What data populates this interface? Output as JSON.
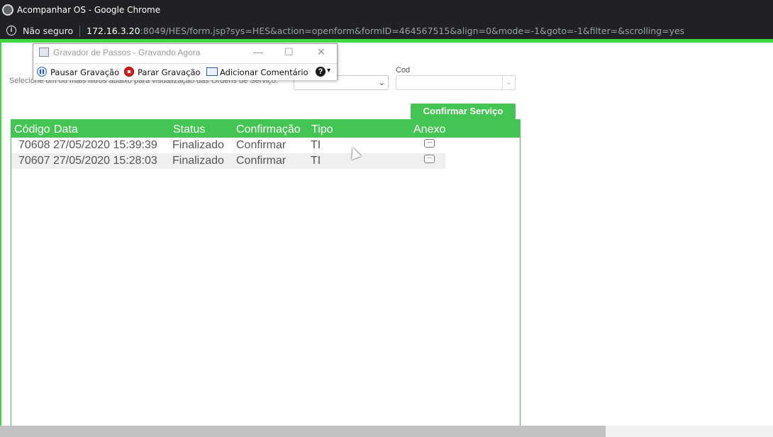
{
  "window": {
    "title": "Acompanhar OS - Google Chrome"
  },
  "addressbar": {
    "security_label": "Não seguro",
    "url_host": "172.16.3.20",
    "url_rest": ":8049/HES/form.jsp?sys=HES&action=openform&formID=464567515&align=0&mode=-1&goto=-1&filter=&scrolling=yes"
  },
  "recorder": {
    "title": "Gravador de Passos - Gravando Agora",
    "minimize": "—",
    "maximize": "☐",
    "close": "✕",
    "pause_label": "Pausar Gravação",
    "stop_label": "Parar Gravação",
    "comment_label": "Adicionar Comentário",
    "help_label": "?",
    "help_chevron": "▾"
  },
  "filters": {
    "hint": "Selecione um ou mais filtros abaixo para visualização das Ordens de Serviço.",
    "cod_label": "Cod",
    "select1_value": "",
    "select2_value": "",
    "chevron": "⌄"
  },
  "actions": {
    "confirm_label": "Confirmar Serviço"
  },
  "table": {
    "headers": {
      "codigo": "Código",
      "data": "Data",
      "status": "Status",
      "confirmacao": "Confirmação",
      "tipo": "Tipo",
      "anexo": "Anexo"
    },
    "rows": [
      {
        "codigo": "70608",
        "data": "27/05/2020 15:39:39",
        "status": "Finalizado",
        "confirmacao": "Confirmar",
        "tipo": "TI",
        "anexo": "···"
      },
      {
        "codigo": "70607",
        "data": "27/05/2020 15:28:03",
        "status": "Finalizado",
        "confirmacao": "Confirmar",
        "tipo": "TI",
        "anexo": "···"
      }
    ]
  },
  "colors": {
    "accent_green": "#44c553",
    "chrome_dark": "#202124"
  }
}
